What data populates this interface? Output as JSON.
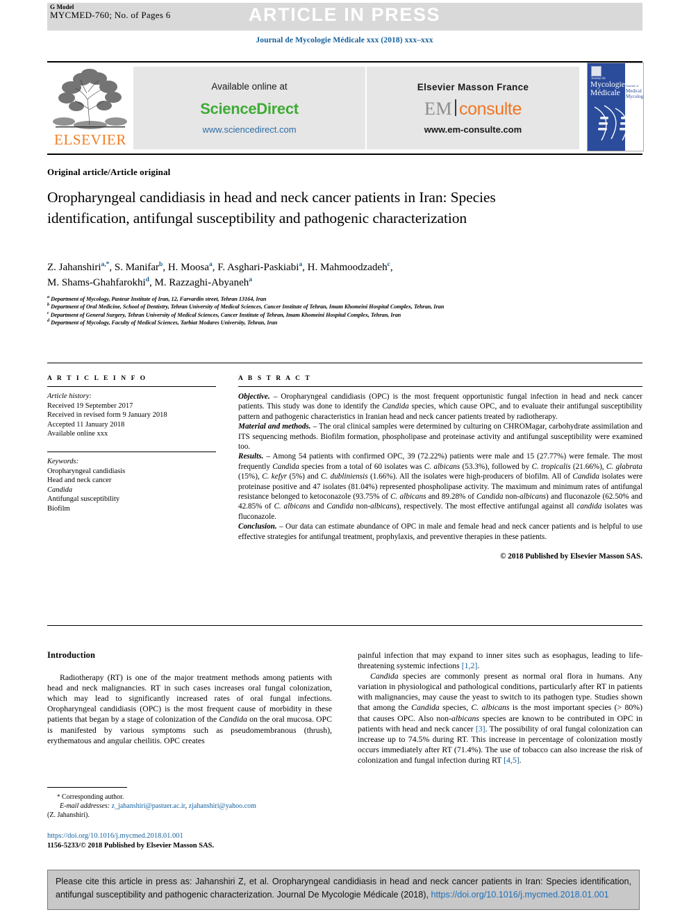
{
  "header": {
    "g_model_label": "G Model",
    "manuscript_id": "MYCMED-760; No. of Pages 6",
    "article_in_press": "ARTICLE IN PRESS",
    "journal_line": "Journal de Mycologie Médicale xxx (2018) xxx–xxx"
  },
  "banner": {
    "elsevier_wordmark": "ELSEVIER",
    "available_online": "Available online at",
    "sciencedirect_logo": "ScienceDirect",
    "sciencedirect_url": "www.sciencedirect.com",
    "elsevier_masson": "Elsevier Masson France",
    "em_logo_left": "EM",
    "em_logo_right": "consulte",
    "em_url": "www.em-consulte.com",
    "cover": {
      "line_small": "Journal de",
      "title_line1": "Mycologie",
      "title_line2": "Médicale",
      "side_small": "Journal of",
      "side_line1": "Medical",
      "side_line2": "Mycology"
    }
  },
  "article": {
    "type": "Original article/Article original",
    "title": "Oropharyngeal candidiasis in head and neck cancer patients in Iran: Species identification, antifungal susceptibility and pathogenic characterization",
    "authors_line1": "Z. Jahanshiri<sup>a,*</sup>, S. Manifar<sup>b</sup>, H. Moosa<sup>a</sup>, F. Asghari-Paskiabi<sup>a</sup>, H. Mahmoodzadeh<sup>c</sup>,",
    "authors_line2": "M. Shams-Ghahfarokhi<sup>d</sup>, M. Razzaghi-Abyaneh<sup>a</sup>",
    "affiliations": [
      "<sup>a</sup> Department of Mycology, Pasteur Institute of Iran, 12, Farvardin street, Tehran 13164, Iran",
      "<sup>b</sup> Department of Oral Medicine, School of Dentistry, Tehran University of Medical Sciences, Cancer Institute of Tehran, Imam Khomeini Hospital Complex, Tehran, Iran",
      "<sup>c</sup> Department of General Surgery, Tehran University of Medical Sciences, Cancer Institute of Tehran, Imam Khomeini Hospital Complex, Tehran, Iran",
      "<sup>d</sup> Department of Mycology, Faculty of Medical Sciences, Tarbiat Modares University, Tehran, Iran"
    ]
  },
  "article_info": {
    "heading": "A R T I C L E   I N F O",
    "history_label": "Article history:",
    "history": [
      "Received 19 September 2017",
      "Received in revised form 9 January 2018",
      "Accepted 11 January 2018",
      "Available online xxx"
    ],
    "keywords_label": "Keywords:",
    "keywords": [
      "Oropharyngeal candidiasis",
      "Head and neck cancer",
      "Candida",
      "Antifungal susceptibility",
      "Biofilm"
    ]
  },
  "abstract": {
    "heading": "A B S T R A C T",
    "objective_label": "Objective.",
    "objective_text": " – Oropharyngeal candidiasis (OPC) is the most frequent opportunistic fungal infection in head and neck cancer patients. This study was done to identify the <i>Candida</i> species, which cause OPC, and to evaluate their antifungal susceptibility pattern and pathogenic characteristics in Iranian head and neck cancer patients treated by radiotherapy.",
    "methods_label": "Material and methods.",
    "methods_text": " – The oral clinical samples were determined by culturing on CHROMagar, carbohydrate assimilation and ITS sequencing methods. Biofilm formation, phospholipase and proteinase activity and antifungal susceptibility were examined too.",
    "results_label": "Results.",
    "results_text": " – Among 54 patients with confirmed OPC, 39 (72.22%) patients were male and 15 (27.77%) were female. The most frequently <i>Candida</i> species from a total of 60 isolates was <i>C. albicans</i> (53.3%), followed by <i>C. tropicalis</i> (21.66%), <i>C. glabrata</i> (15%), <i>C. kefyr</i> (5%) and <i>C. dubliniensis</i> (1.66%). All the isolates were high-producers of biofilm. All of <i>Candida</i> isolates were proteinase positive and 47 isolates (81.04%) represented phospholipase activity. The maximum and minimum rates of antifungal resistance belonged to ketoconazole (93.75% of <i>C. albicans</i> and 89.28% of <i>Candida</i> non-<i>albicans</i>) and fluconazole (62.50% and 42.85% of <i>C. albicans</i> and <i>Candida</i> non-<i>albicans</i>), respectively. The most effective antifungal against all <i>candida</i> isolates was fluconazole.",
    "conclusion_label": "Conclusion.",
    "conclusion_text": " – Our data can estimate abundance of OPC in male and female head and neck cancer patients and is helpful to use effective strategies for antifungal treatment, prophylaxis, and preventive therapies in these patients.",
    "copyright": "© 2018 Published by Elsevier Masson SAS."
  },
  "introduction": {
    "heading": "Introduction",
    "left_paragraph": "Radiotherapy (RT) is one of the major treatment methods among patients with head and neck malignancies. RT in such cases increases oral fungal colonization, which may lead to significantly increased rates of oral fungal infections. Oropharyngeal candidiasis (OPC) is the most frequent cause of morbidity in these patients that began by a stage of colonization of the <i>Candida</i> on the oral mucosa. OPC is manifested by various symptoms such as pseudomembranous (thrush), erythematous and angular cheilitis. OPC creates",
    "right_paragraph_1": "painful infection that may expand to inner sites such as esophagus, leading to life-threatening systemic infections <span class=\"ref\">[1,2]</span>.",
    "right_paragraph_2": "<i>Candida</i> species are commonly present as normal oral flora in humans. Any variation in physiological and pathological conditions, particularly after RT in patients with malignancies, may cause the yeast to switch to its pathogen type. Studies shown that among the <i>Candida</i> species, <i>C. albicans</i> is the most important species (&gt; 80%) that causes OPC. Also non-<i>albicans</i> species are known to be contributed in OPC in patients with head and neck cancer <span class=\"ref\">[3]</span>. The possibility of oral fungal colonization can increase up to 74.5% during RT. This increase in percentage of colonization mostly occurs immediately after RT (71.4%). The use of tobacco can also increase the risk of colonization and fungal infection during RT <span class=\"ref\">[4,5]</span>."
  },
  "footnotes": {
    "corresponding_author": "Corresponding author.",
    "email_label": "E-mail addresses:",
    "email_1": "z_jahanshiri@pastuer.ac.ir",
    "email_2": "zjahanshiri@yahoo.com",
    "email_owner": "(Z. Jahanshiri).",
    "doi": "https://doi.org/10.1016/j.mycmed.2018.01.001",
    "issn_line": "1156-5233/© 2018 Published by Elsevier Masson SAS."
  },
  "citation_box": {
    "text": "Please cite this article in press as: Jahanshiri Z, et al. Oropharyngeal candidiasis in head and neck cancer patients in Iran: Species identification, antifungal susceptibility and pathogenic characterization. Journal De Mycologie Médicale (2018), ",
    "link": "https://doi.org/10.1016/j.mycmed.2018.01.001"
  },
  "colors": {
    "link_blue": "#14609c",
    "sciencedirect_green": "#3eab35",
    "elsevier_orange": "#f47c20",
    "em_orange": "#ef7622",
    "header_grey": "#d9d9d9",
    "cite_box_grey": "#c8c8c8"
  }
}
